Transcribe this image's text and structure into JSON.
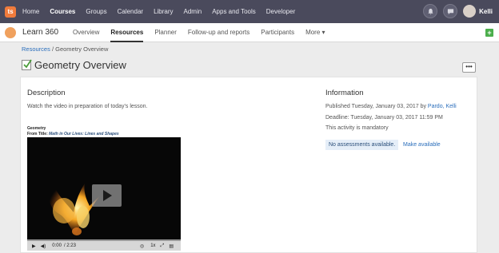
{
  "nav": {
    "logo_text": "ts",
    "items": [
      "Home",
      "Courses",
      "Groups",
      "Calendar",
      "Library",
      "Admin",
      "Apps and Tools",
      "Developer"
    ],
    "active": "Courses",
    "user_name": "Kelli"
  },
  "subnav": {
    "course_name": "Learn 360",
    "items": [
      "Overview",
      "Resources",
      "Planner",
      "Follow-up and reports",
      "Participants",
      "More"
    ],
    "active": "Resources",
    "more_caret": "▾",
    "plus": "+"
  },
  "breadcrumb": {
    "link": "Resources",
    "separator": " / ",
    "current": "Geometry Overview"
  },
  "page_title": "Geometry Overview",
  "more_button": "•••",
  "description": {
    "heading": "Description",
    "text": "Watch the video in preparation of today's lesson."
  },
  "video": {
    "title": "Geometry",
    "from_prefix": "From Title: ",
    "from_title": "Math in Our Lives: Lines and Shapes",
    "time": "0:00",
    "duration": "/ 2:23",
    "speed": "1x",
    "progress": 0
  },
  "information": {
    "heading": "Information",
    "published_prefix": "Published Tuesday, January 03, 2017 by ",
    "published_author": "Pardo, Kelli",
    "deadline": "Deadline: Tuesday, January 03, 2017 11:59 PM",
    "mandatory": "This activity is mandatory",
    "no_assessments": "No assessments available.",
    "make_available": "Make available"
  },
  "colors": {
    "topnav_bg": "#4a4a5c",
    "accent_orange": "#f07b3c",
    "link_blue": "#2a6ebb",
    "add_green": "#4cae4c"
  }
}
